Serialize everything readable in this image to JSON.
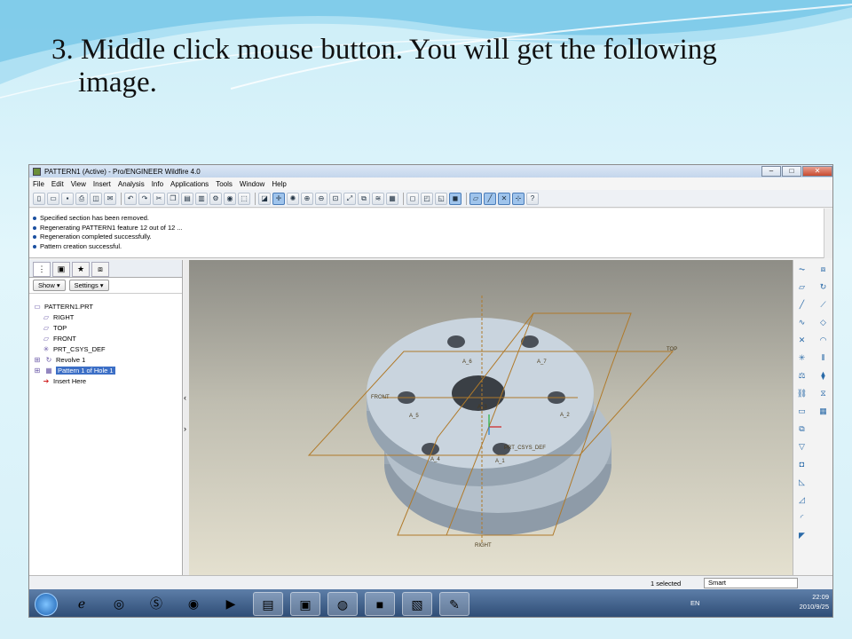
{
  "slide": {
    "title_num": "3.",
    "title_line1": "Middle click mouse button. You will get the following",
    "title_line2": "image."
  },
  "window": {
    "title": "PATTERN1 (Active) - Pro/ENGINEER Wildfire 4.0",
    "menu": [
      "File",
      "Edit",
      "View",
      "Insert",
      "Analysis",
      "Info",
      "Applications",
      "Tools",
      "Window",
      "Help"
    ]
  },
  "messages": [
    "Specified section has been removed.",
    "Regenerating PATTERN1 feature 12 out of 12 ...",
    "Regeneration completed successfully.",
    "Pattern creation successful."
  ],
  "navigator": {
    "show_label": "Show ▾",
    "settings_label": "Settings ▾",
    "tree": [
      {
        "label": "PATTERN1.PRT",
        "icon": "part-icon"
      },
      {
        "label": "RIGHT",
        "icon": "datum-plane-icon"
      },
      {
        "label": "TOP",
        "icon": "datum-plane-icon"
      },
      {
        "label": "FRONT",
        "icon": "datum-plane-icon"
      },
      {
        "label": "PRT_CSYS_DEF",
        "icon": "csys-icon"
      },
      {
        "label": "Revolve 1",
        "icon": "revolve-icon"
      },
      {
        "label": "Pattern 1 of Hole 1",
        "icon": "pattern-icon"
      },
      {
        "label": "Insert Here",
        "icon": "insert-arrow-icon"
      }
    ]
  },
  "viewport": {
    "labels": {
      "top": "TOP",
      "front": "FRONT",
      "right": "RIGHT",
      "csys": "PRT_CSYS_DEF",
      "a1": "A_1",
      "a2": "A_2",
      "a3": "A_3",
      "a4": "A_4",
      "a5": "A_5",
      "a6": "A_6",
      "a7": "A_7"
    }
  },
  "statusbar": {
    "selected": "1 selected",
    "filter": "Smart"
  },
  "taskbar": {
    "lang": "EN",
    "time": "22:09",
    "date": "2010/9/25"
  },
  "colors": {
    "datum": "#b07a2a",
    "part_face": "#c9d4de",
    "part_side": "#9aa9b6"
  }
}
